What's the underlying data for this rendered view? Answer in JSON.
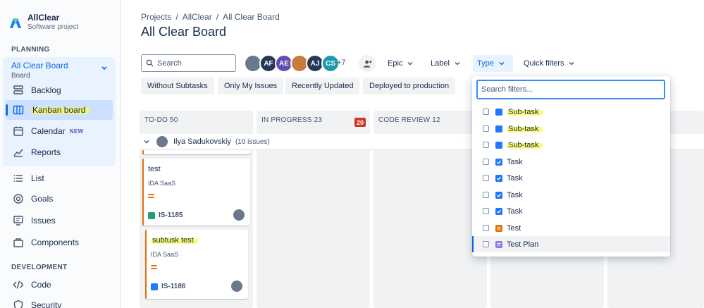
{
  "sidebar": {
    "project_name": "AllClear",
    "project_type": "Software project",
    "planning_label": "PLANNING",
    "board_selector": {
      "title": "All Clear Board",
      "subtitle": "Board"
    },
    "planning_items": [
      {
        "label": "Backlog",
        "icon": "backlog-icon"
      },
      {
        "label": "Kanban board",
        "icon": "board-icon",
        "active": true
      },
      {
        "label": "Calendar",
        "icon": "calendar-icon",
        "badge": "NEW"
      },
      {
        "label": "Reports",
        "icon": "reports-icon"
      }
    ],
    "other_items": [
      {
        "label": "List",
        "icon": "list-icon"
      },
      {
        "label": "Goals",
        "icon": "goals-icon"
      },
      {
        "label": "Issues",
        "icon": "issues-icon"
      },
      {
        "label": "Components",
        "icon": "components-icon"
      }
    ],
    "development_label": "DEVELOPMENT",
    "development_items": [
      {
        "label": "Code",
        "icon": "code-icon"
      },
      {
        "label": "Security",
        "icon": "security-icon"
      }
    ]
  },
  "header": {
    "breadcrumbs": [
      "Projects",
      "AllClear",
      "All Clear Board"
    ],
    "title": "All Clear Board"
  },
  "toolbar": {
    "search_placeholder": "Search",
    "avatars": [
      {
        "initials": "",
        "color": "#6b778c"
      },
      {
        "initials": "AF",
        "color": "#253858"
      },
      {
        "initials": "AE",
        "color": "#5e4db2"
      },
      {
        "initials": "",
        "color": "#c77c3c"
      },
      {
        "initials": "AJ",
        "color": "#253858"
      },
      {
        "initials": "CS",
        "color": "#1d9aaa"
      }
    ],
    "more_count": "+7",
    "filters": [
      {
        "label": "Epic"
      },
      {
        "label": "Label"
      },
      {
        "label": "Type",
        "open": true
      },
      {
        "label": "Quick filters"
      }
    ],
    "quick_filters": [
      "Without Subtasks",
      "Only My Issues",
      "Recently Updated",
      "Deployed to production"
    ]
  },
  "board": {
    "columns": [
      {
        "name": "TO-DO 50"
      },
      {
        "name": "IN PROGRESS 23",
        "wip": "20"
      },
      {
        "name": "CODE REVIEW 12"
      }
    ],
    "swimlane": {
      "name": "Ilya Sadukovskiy",
      "count": "(10 issues)"
    },
    "cards": [
      {
        "title": "test",
        "epic": "IDA SaaS",
        "key": "IS-1185",
        "type_color": "#22a06b"
      },
      {
        "title": "subtusk test",
        "epic": "IDA SaaS",
        "key": "IS-1186",
        "type_color": "#1d7afc"
      }
    ]
  },
  "type_dropdown": {
    "search_placeholder": "Search filters...",
    "options": [
      {
        "label": "Sub-task",
        "color": "#1d7afc",
        "highlight": true
      },
      {
        "label": "Sub-task",
        "color": "#1d7afc",
        "highlight": true
      },
      {
        "label": "Sub-task",
        "color": "#1d7afc",
        "highlight": true
      },
      {
        "label": "Task",
        "color": "#1d7afc"
      },
      {
        "label": "Task",
        "color": "#1d7afc"
      },
      {
        "label": "Task",
        "color": "#1d7afc"
      },
      {
        "label": "Task",
        "color": "#1d7afc"
      },
      {
        "label": "Test",
        "color": "#e2740f"
      },
      {
        "label": "Test Plan",
        "color": "#8f7ee7"
      }
    ]
  }
}
